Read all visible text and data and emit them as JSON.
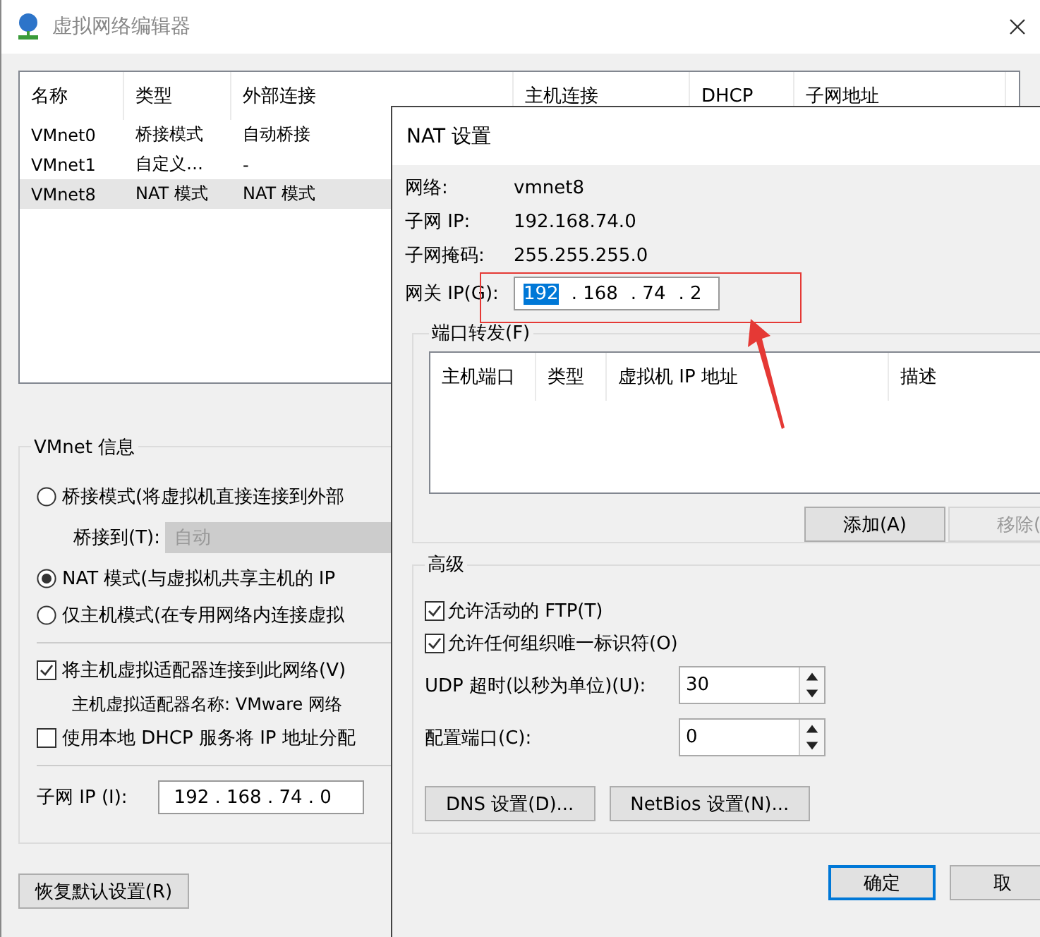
{
  "window": {
    "title": "虚拟网络编辑器"
  },
  "networks": {
    "columns": [
      "名称",
      "类型",
      "外部连接",
      "主机连接",
      "DHCP",
      "子网地址"
    ],
    "rows": [
      {
        "cells": [
          "VMnet0",
          "桥接模式",
          "自动桥接"
        ],
        "selected": false
      },
      {
        "cells": [
          "VMnet1",
          "自定义…",
          "-"
        ],
        "selected": false
      },
      {
        "cells": [
          "VMnet8",
          "NAT 模式",
          "NAT 模式"
        ],
        "selected": true
      }
    ]
  },
  "vmnet_info": {
    "title": "VMnet 信息",
    "bridge_mode": {
      "label": "桥接模式(将虚拟机直接连接到外部",
      "selected": false
    },
    "bridge_to": {
      "label": "桥接到(T):",
      "value": "自动"
    },
    "nat_mode": {
      "label": "NAT 模式(与虚拟机共享主机的 IP",
      "selected": true
    },
    "host_only_mode": {
      "label": "仅主机模式(在专用网络内连接虚拟",
      "selected": false
    },
    "connect_adapter": {
      "label": "将主机虚拟适配器连接到此网络(V)",
      "checked": true
    },
    "adapter_name": "主机虚拟适配器名称: VMware 网络",
    "use_dhcp": {
      "label": "使用本地 DHCP 服务将 IP 地址分配",
      "checked": false
    },
    "subnet_ip": {
      "label": "子网 IP (I):",
      "value": "192 . 168 . 74 . 0"
    }
  },
  "restore_button": "恢复默认设置(R)",
  "nat_dialog": {
    "title": "NAT 设置",
    "info": [
      {
        "label": "网络:",
        "value": "vmnet8"
      },
      {
        "label": "子网 IP:",
        "value": "192.168.74.0"
      },
      {
        "label": "子网掩码:",
        "value": "255.255.255.0"
      }
    ],
    "gateway": {
      "label": "网关 IP(G):",
      "octets": [
        {
          "text": "192",
          "selected": true
        },
        {
          "text": ". 168",
          "selected": false
        },
        {
          "text": ". 74",
          "selected": false
        },
        {
          "text": ". 2",
          "selected": false
        }
      ]
    },
    "port_forwarding": {
      "title": "端口转发(F)",
      "columns": [
        "主机端口",
        "类型",
        "虚拟机 IP 地址",
        "描述"
      ],
      "buttons": [
        {
          "label": "添加(A)",
          "disabled": false
        },
        {
          "label": "移除(",
          "disabled": true
        }
      ]
    },
    "advanced": {
      "title": "高级",
      "options": [
        {
          "label": "允许活动的 FTP(T)",
          "checked": true
        },
        {
          "label": "允许任何组织唯一标识符(O)",
          "checked": true
        }
      ],
      "fields": [
        {
          "label": "UDP 超时(以秒为单位)(U):",
          "value": "30"
        },
        {
          "label": "配置端口(C):",
          "value": "0"
        }
      ],
      "buttons": [
        "DNS 设置(D)...",
        "NetBios 设置(N)..."
      ]
    },
    "footer_buttons": [
      {
        "label": "确定",
        "default": true
      },
      {
        "label": "取",
        "default": false
      }
    ]
  }
}
